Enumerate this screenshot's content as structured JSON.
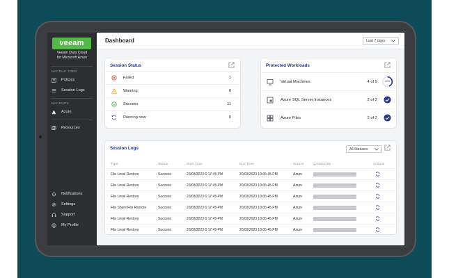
{
  "sidebar": {
    "logo": "veeam",
    "logo_subtitle_1": "Veeam Data Cloud",
    "logo_subtitle_2": "for Microsoft Azure",
    "sections": {
      "backup_jobs": "BACKUP JOBS",
      "backups": "BACKUPS"
    },
    "items": {
      "policies": "Policies",
      "session_logs": "Session Logs",
      "azure": "Azure",
      "resources": "Resources",
      "notifications": "Notifications",
      "settings": "Settings",
      "support": "Support",
      "my_profile": "My Profile"
    }
  },
  "header": {
    "title": "Dashboard",
    "range": "Last 7 days"
  },
  "session_status": {
    "title": "Session Status",
    "rows": [
      {
        "label": "Failed",
        "value": "1",
        "icon": "failed-icon",
        "color": "#e0473e"
      },
      {
        "label": "Warning",
        "value": "0",
        "icon": "warning-icon",
        "color": "#f0a531"
      },
      {
        "label": "Success",
        "value": "11",
        "icon": "success-icon",
        "color": "#4caf50"
      },
      {
        "label": "Running now",
        "value": "0",
        "icon": "running-icon",
        "color": "#3f51b5"
      }
    ]
  },
  "protected_workloads": {
    "title": "Protected Workloads",
    "rows": [
      {
        "label": "Virtual Machines",
        "count": "4 of 9",
        "progress_label": "44%",
        "progress": 0.44
      },
      {
        "label": "Azure SQL Server Instances",
        "count": "2 of 2"
      },
      {
        "label": "Azure Files",
        "count": "2 of 2"
      }
    ]
  },
  "session_logs": {
    "title": "Session Logs",
    "filter": "All Statuses",
    "columns": [
      "Type",
      "Status",
      "Start Time",
      "End Time",
      "Source",
      "Created By",
      "Actions"
    ],
    "rows": [
      {
        "type": "File Level Restore",
        "status": "Success",
        "start": "20/03/2023 6:17:45 PM",
        "end": "20/03/2023 10:05:45 PM",
        "source": "Azure"
      },
      {
        "type": "File Level Restore",
        "status": "Success",
        "start": "20/03/2023 6:17:45 PM",
        "end": "20/03/2023 10:05:45 PM",
        "source": "Azure"
      },
      {
        "type": "File Level Restore",
        "status": "Success",
        "start": "20/03/2023 6:17:45 PM",
        "end": "20/03/2023 10:05:45 PM",
        "source": "Azure"
      },
      {
        "type": "File Share File Restore",
        "status": "Success",
        "start": "20/03/2023 6:17:45 PM",
        "end": "20/03/2023 10:05:45 PM",
        "source": "Azure"
      },
      {
        "type": "File Level Restore",
        "status": "Success",
        "start": "20/03/2023 6:17:45 PM",
        "end": "20/03/2023 10:05:45 PM",
        "source": "Azure"
      },
      {
        "type": "File Level Restore",
        "status": "Success",
        "start": "20/03/2023 6:17:45 PM",
        "end": "20/03/2023 10:05:45 PM",
        "source": "Azure"
      }
    ]
  },
  "colors": {
    "brand": "#54b948",
    "accent": "#243a8c",
    "background": "#0d4b59"
  }
}
